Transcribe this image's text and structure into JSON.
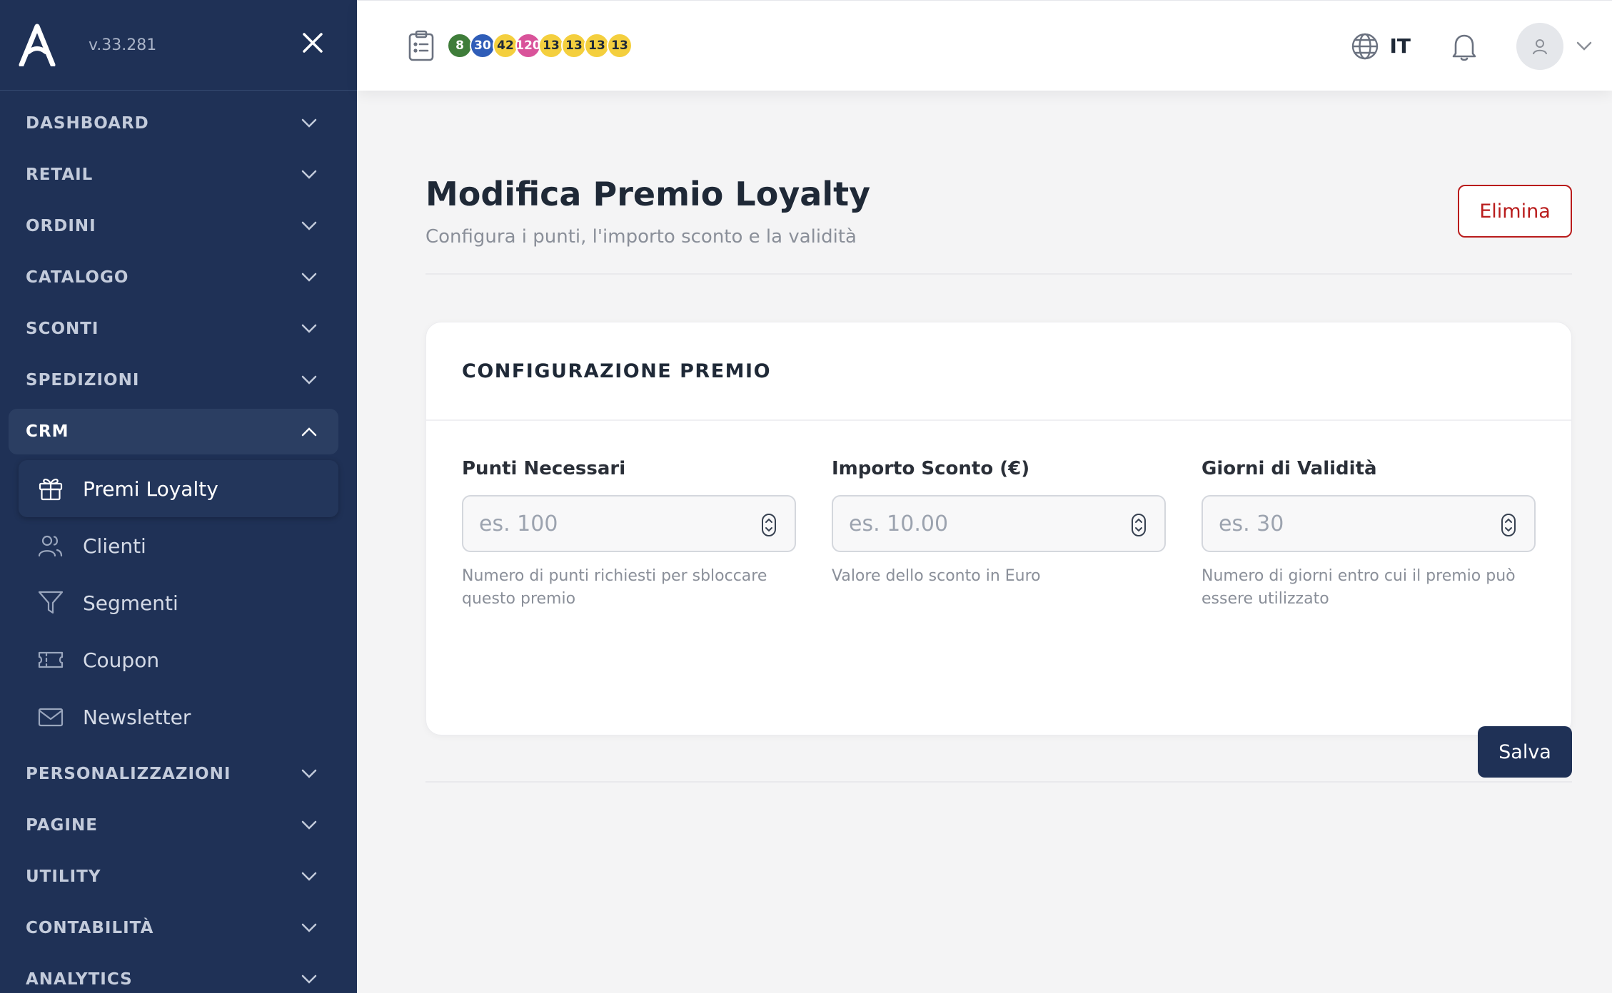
{
  "app": {
    "version": "v.33.281"
  },
  "sidebar": {
    "items_top": [
      {
        "label": "DASHBOARD"
      },
      {
        "label": "RETAIL"
      },
      {
        "label": "ORDINI"
      },
      {
        "label": "CATALOGO"
      },
      {
        "label": "SCONTI"
      },
      {
        "label": "SPEDIZIONI"
      }
    ],
    "open_section": {
      "label": "CRM"
    },
    "sub_items": [
      {
        "label": "Premi Loyalty",
        "icon": "gift-icon",
        "active": true
      },
      {
        "label": "Clienti",
        "icon": "users-icon"
      },
      {
        "label": "Segmenti",
        "icon": "filter-icon"
      },
      {
        "label": "Coupon",
        "icon": "ticket-icon"
      },
      {
        "label": "Newsletter",
        "icon": "mail-icon"
      }
    ],
    "items_bottom": [
      {
        "label": "PERSONALIZZAZIONI"
      },
      {
        "label": "PAGINE"
      },
      {
        "label": "UTILITY"
      },
      {
        "label": "CONTABILITÀ"
      },
      {
        "label": "ANALYTICS"
      }
    ]
  },
  "topbar": {
    "badges": [
      {
        "value": "8",
        "color": "#3f7d3a",
        "text_color": "#ffffff"
      },
      {
        "value": "30",
        "color": "#2f5db8",
        "text_color": "#ffffff"
      },
      {
        "value": "42",
        "color": "#f4cf3e",
        "text_color": "#1f2937"
      },
      {
        "value": "120",
        "color": "#d9539a",
        "text_color": "#ffffff"
      },
      {
        "value": "13",
        "color": "#f4cf3e",
        "text_color": "#1f2937"
      },
      {
        "value": "13",
        "color": "#f4cf3e",
        "text_color": "#1f2937"
      },
      {
        "value": "13",
        "color": "#f4cf3e",
        "text_color": "#1f2937"
      },
      {
        "value": "13",
        "color": "#f4cf3e",
        "text_color": "#1f2937"
      }
    ],
    "language": "IT"
  },
  "page": {
    "title": "Modifica Premio Loyalty",
    "subtitle": "Configura i punti, l'importo sconto e la validità",
    "delete_label": "Elimina",
    "save_label": "Salva"
  },
  "card": {
    "title": "CONFIGURAZIONE PREMIO",
    "fields": [
      {
        "label": "Punti Necessari",
        "placeholder": "es. 100",
        "value": "",
        "hint": "Numero di punti richiesti per sbloccare questo premio"
      },
      {
        "label": "Importo Sconto (€)",
        "placeholder": "es. 10.00",
        "value": "",
        "hint": "Valore dello sconto in Euro"
      },
      {
        "label": "Giorni di Validità",
        "placeholder": "es. 30",
        "value": "",
        "hint": "Numero di giorni entro cui il premio può essere utilizzato"
      }
    ]
  },
  "colors": {
    "sidebar_bg": "#1f3156",
    "accent_danger": "#b91c1c",
    "primary": "#1f3156"
  }
}
